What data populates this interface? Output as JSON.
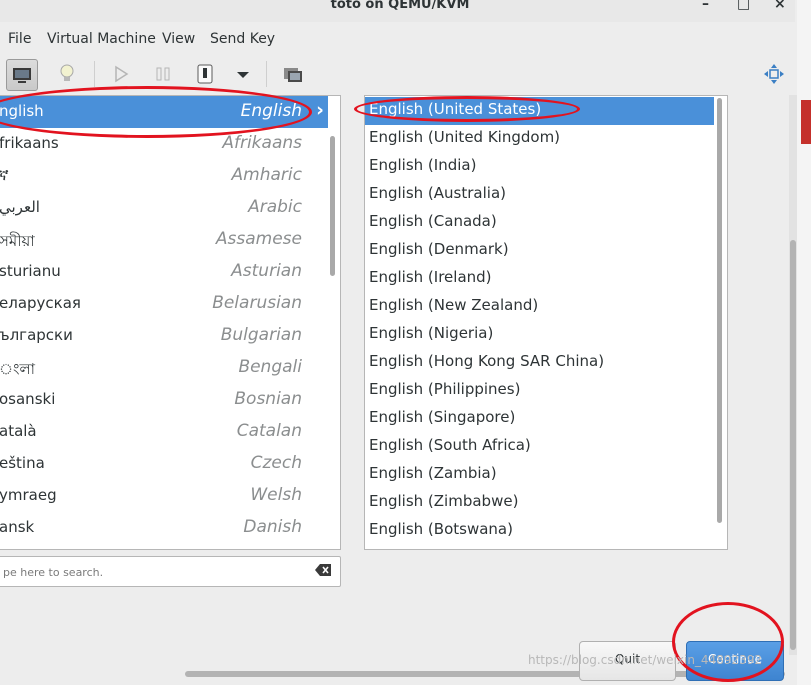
{
  "window": {
    "title": "toto on QEMU/KVM",
    "controls": [
      "–",
      "□",
      "×"
    ]
  },
  "menu": [
    "File",
    "Virtual Machine",
    "View",
    "Send Key"
  ],
  "toolbar": {
    "buttons": [
      "console-view",
      "details-view",
      "run",
      "pause",
      "shutdown",
      "shutdown-menu",
      "snapshots",
      "fullscreen"
    ]
  },
  "languages": [
    {
      "native": "nglish",
      "english": "English",
      "selected": true
    },
    {
      "native": "frikaans",
      "english": "Afrikaans"
    },
    {
      "native": "ኛ",
      "english": "Amharic"
    },
    {
      "native": "العربي",
      "english": "Arabic"
    },
    {
      "native": "সমীয়া",
      "english": "Assamese"
    },
    {
      "native": "sturianu",
      "english": "Asturian"
    },
    {
      "native": "еларуская",
      "english": "Belarusian"
    },
    {
      "native": "ългарски",
      "english": "Bulgarian"
    },
    {
      "native": "ংলা",
      "english": "Bengali"
    },
    {
      "native": "osanski",
      "english": "Bosnian"
    },
    {
      "native": "atalà",
      "english": "Catalan"
    },
    {
      "native": "eština",
      "english": "Czech"
    },
    {
      "native": "ymraeg",
      "english": "Welsh"
    },
    {
      "native": "ansk",
      "english": "Danish"
    }
  ],
  "locales": [
    {
      "label": "English (United States)",
      "selected": true
    },
    {
      "label": "English (United Kingdom)"
    },
    {
      "label": "English (India)"
    },
    {
      "label": "English (Australia)"
    },
    {
      "label": "English (Canada)"
    },
    {
      "label": "English (Denmark)"
    },
    {
      "label": "English (Ireland)"
    },
    {
      "label": "English (New Zealand)"
    },
    {
      "label": "English (Nigeria)"
    },
    {
      "label": "English (Hong Kong SAR China)"
    },
    {
      "label": "English (Philippines)"
    },
    {
      "label": "English (Singapore)"
    },
    {
      "label": "English (South Africa)"
    },
    {
      "label": "English (Zambia)"
    },
    {
      "label": "English (Zimbabwe)"
    },
    {
      "label": "English (Botswana)"
    }
  ],
  "search": {
    "placeholder": "pe here to search."
  },
  "buttons": {
    "quit": "Quit",
    "continue": "Continue"
  },
  "watermark": "https://blog.csdn.net/weixin_44892392",
  "colors": {
    "selection": "#4a90d9",
    "annotation": "#e2131f"
  }
}
